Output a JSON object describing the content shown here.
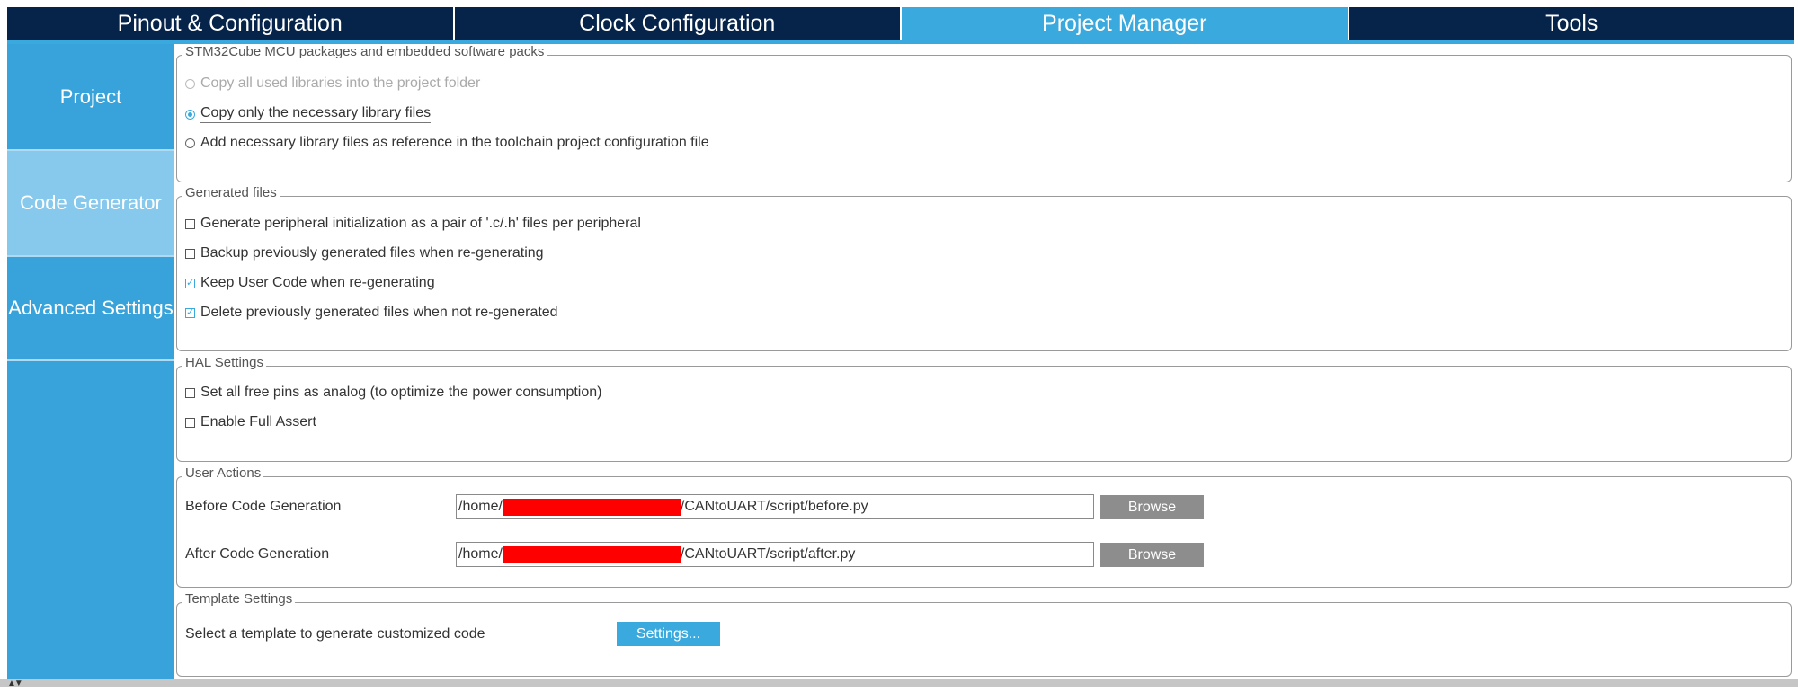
{
  "top_tabs": [
    {
      "label": "Pinout & Configuration"
    },
    {
      "label": "Clock Configuration"
    },
    {
      "label": "Project Manager"
    },
    {
      "label": "Tools"
    }
  ],
  "active_top_tab": "Project Manager",
  "sidebar": {
    "items": [
      {
        "label": "Project"
      },
      {
        "label": "Code Generator"
      },
      {
        "label": "Advanced Settings"
      }
    ],
    "selected": "Code Generator"
  },
  "packages": {
    "title": "STM32Cube MCU packages and embedded software packs",
    "options": [
      {
        "label": "Copy all used libraries into the project folder",
        "selected": false,
        "enabled": false
      },
      {
        "label": "Copy only the necessary library files",
        "selected": true,
        "enabled": true
      },
      {
        "label": "Add necessary library files as reference in the toolchain project configuration file",
        "selected": false,
        "enabled": true
      }
    ]
  },
  "generated_files": {
    "title": "Generated files",
    "options": [
      {
        "label": "Generate peripheral initialization as a pair of '.c/.h' files per peripheral",
        "checked": false
      },
      {
        "label": "Backup previously generated files when re-generating",
        "checked": false
      },
      {
        "label": "Keep User Code when re-generating",
        "checked": true
      },
      {
        "label": "Delete previously generated files when not re-generated",
        "checked": true
      }
    ]
  },
  "hal_settings": {
    "title": "HAL Settings",
    "options": [
      {
        "label": "Set all free pins as analog (to optimize the power consumption)",
        "checked": false
      },
      {
        "label": "Enable Full Assert",
        "checked": false
      }
    ]
  },
  "user_actions": {
    "title": "User Actions",
    "before": {
      "label": "Before Code Generation",
      "path_prefix": "/home/",
      "path_suffix": "/CANtoUART/script/before.py",
      "button": "Browse"
    },
    "after": {
      "label": "After Code Generation",
      "path_prefix": "/home/",
      "path_suffix": "/CANtoUART/script/after.py",
      "button": "Browse"
    }
  },
  "template_settings": {
    "title": "Template Settings",
    "label": "Select a template to generate customized code",
    "button": "Settings..."
  },
  "colors": {
    "navy": "#06234a",
    "accent": "#3aa9dd",
    "sidebar": "#38a3db",
    "sidebar_selected": "#87c9ec",
    "browse_button": "#8d8d8d",
    "redaction": "#ff0000"
  }
}
